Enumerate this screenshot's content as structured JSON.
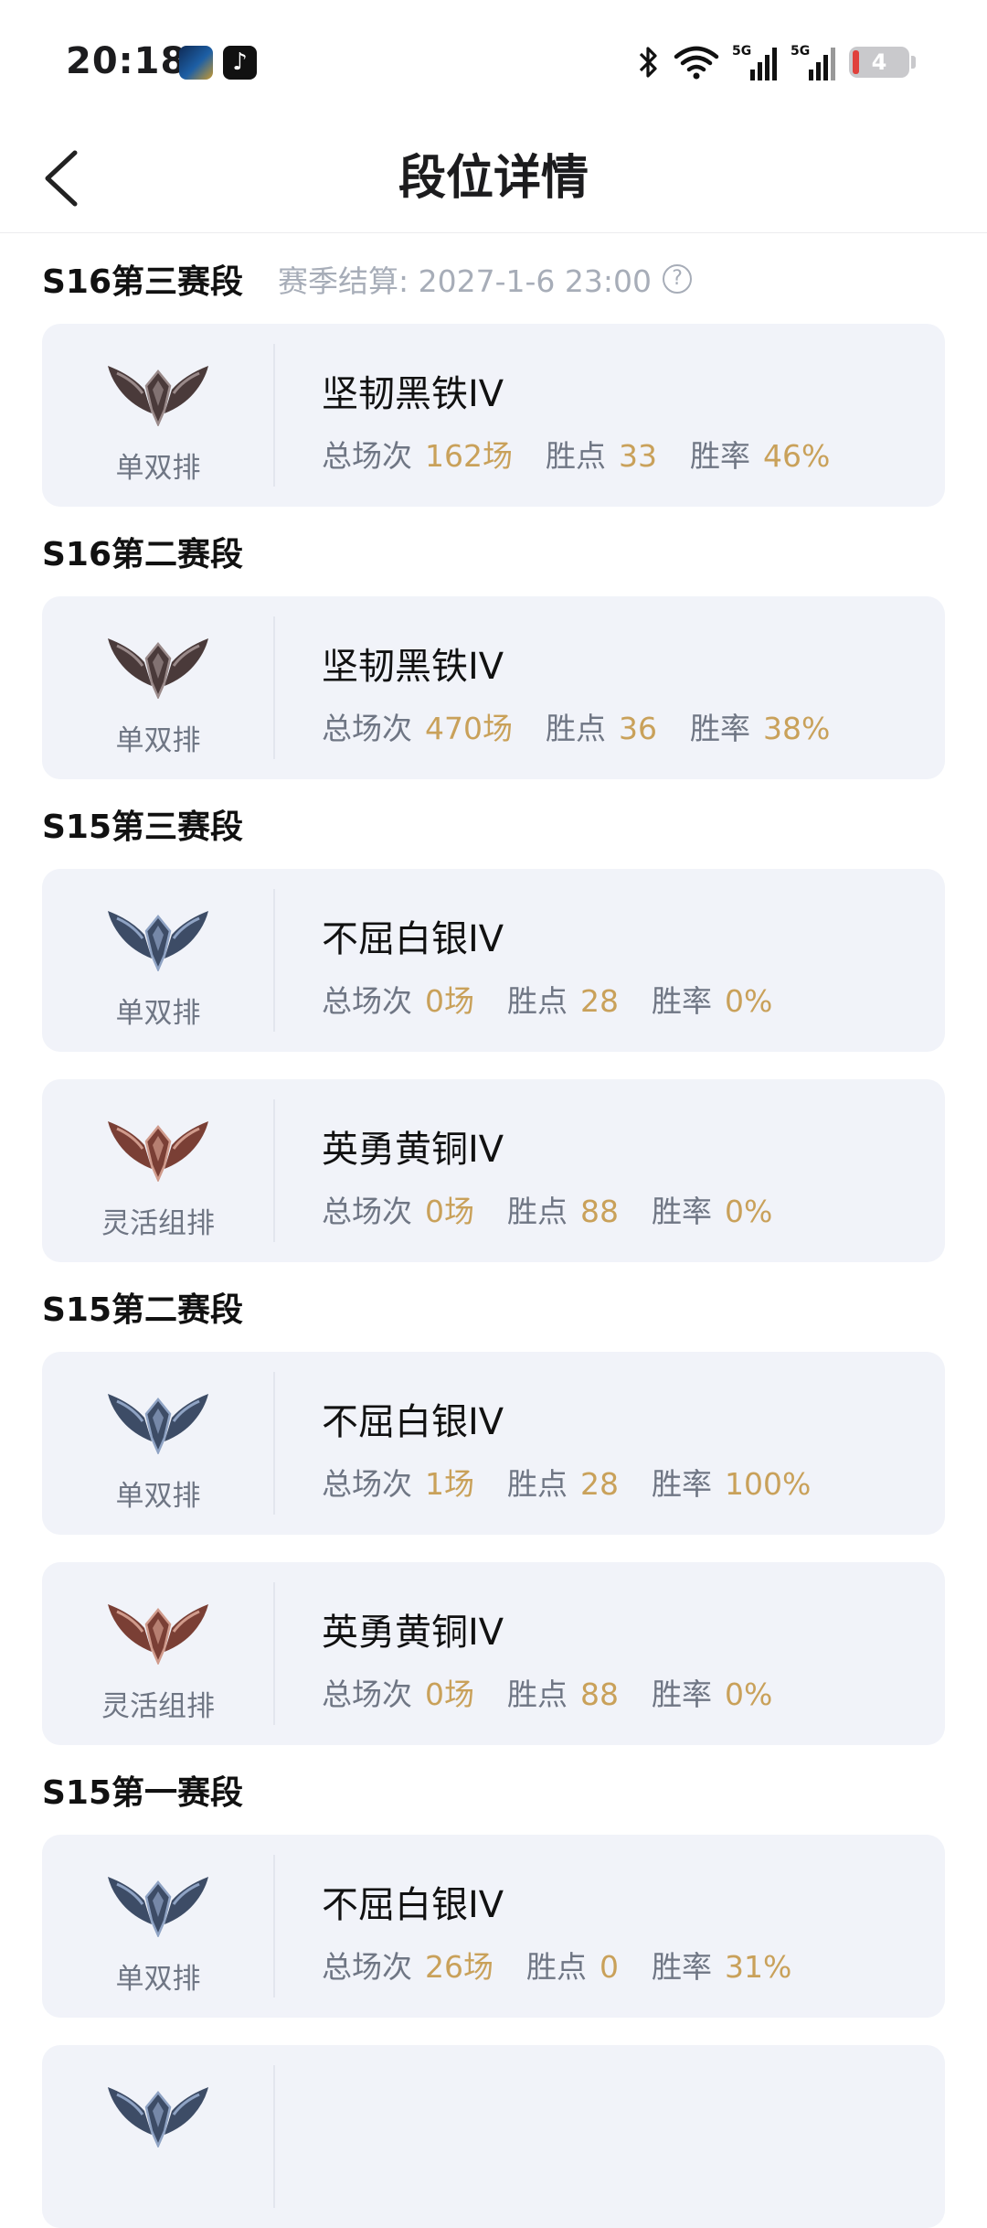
{
  "status_bar": {
    "time": "20:18",
    "apps": [
      "game-app-icon",
      "tiktok-icon"
    ],
    "signal_labels": [
      "5G",
      "5G"
    ],
    "battery": "4"
  },
  "nav": {
    "title": "段位详情",
    "back_icon": "chevron-left-icon"
  },
  "labels": {
    "games": "总场次",
    "points": "胜点",
    "winrate": "胜率"
  },
  "seasons": [
    {
      "name": "S16第三赛段",
      "settle": "赛季结算: 2027-1-6 23:00",
      "cards": [
        {
          "tier": "iron",
          "queue": "单双排",
          "rank": "坚韧黑铁IV",
          "games": "162场",
          "points": "33",
          "winrate": "46%"
        }
      ]
    },
    {
      "name": "S16第二赛段",
      "cards": [
        {
          "tier": "iron",
          "queue": "单双排",
          "rank": "坚韧黑铁IV",
          "games": "470场",
          "points": "36",
          "winrate": "38%"
        }
      ]
    },
    {
      "name": "S15第三赛段",
      "cards": [
        {
          "tier": "silver",
          "queue": "单双排",
          "rank": "不屈白银IV",
          "games": "0场",
          "points": "28",
          "winrate": "0%"
        },
        {
          "tier": "bronze",
          "queue": "灵活组排",
          "rank": "英勇黄铜IV",
          "games": "0场",
          "points": "88",
          "winrate": "0%"
        }
      ]
    },
    {
      "name": "S15第二赛段",
      "cards": [
        {
          "tier": "silver",
          "queue": "单双排",
          "rank": "不屈白银IV",
          "games": "1场",
          "points": "28",
          "winrate": "100%"
        },
        {
          "tier": "bronze",
          "queue": "灵活组排",
          "rank": "英勇黄铜IV",
          "games": "0场",
          "points": "88",
          "winrate": "0%"
        }
      ]
    },
    {
      "name": "S15第一赛段",
      "cards": [
        {
          "tier": "silver",
          "queue": "单双排",
          "rank": "不屈白银IV",
          "games": "26场",
          "points": "0",
          "winrate": "31%"
        },
        {
          "tier": "silver",
          "queue": "",
          "rank": "",
          "games": "",
          "points": "",
          "winrate": ""
        }
      ]
    }
  ],
  "colors": {
    "accent_value": "#c9a15a",
    "card_bg": "#f1f3f9",
    "muted": "#a7adb8",
    "label": "#6f7684",
    "iron": "#4a3a3a",
    "silver": "#3d4c66",
    "bronze": "#7a3f35"
  }
}
